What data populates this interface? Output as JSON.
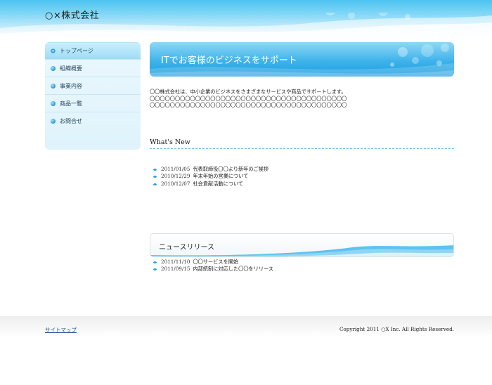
{
  "header": {
    "site_title": "○×株式会社"
  },
  "sidebar": {
    "items": [
      {
        "label": "トップページ",
        "icon": "chevron-up-icon",
        "active": true
      },
      {
        "label": "組織概要",
        "icon": "bullet-icon"
      },
      {
        "label": "事業内容",
        "icon": "bullet-icon"
      },
      {
        "label": "商品一覧",
        "icon": "bullet-icon"
      },
      {
        "label": "お問合せ",
        "icon": "bullet-icon"
      }
    ]
  },
  "main": {
    "banner_title": "ITでお客様のビジネスをサポート",
    "intro_lines": [
      "〇〇株式会社は、中小企業のビジネスをさまざまなサービスや商品でサポートします。",
      "〇〇〇〇〇〇〇〇〇〇〇〇〇〇〇〇〇〇〇〇〇〇〇〇〇〇〇〇〇〇〇〇〇〇〇〇〇〇〇",
      "〇〇〇〇〇〇〇〇〇〇〇〇〇〇〇〇〇〇〇〇〇〇〇〇〇〇〇〇〇〇〇〇〇〇〇〇〇〇〇"
    ],
    "whats_new": {
      "heading": "What's New",
      "items": [
        {
          "date": "2011/01/05",
          "text": "代表取締役〇〇より新年のご挨拶"
        },
        {
          "date": "2010/12/29",
          "text": "年末年始の営業について"
        },
        {
          "date": "2010/12/07",
          "text": "社会貢献活動について"
        }
      ]
    },
    "news_release": {
      "heading": "ニュースリリース",
      "items": [
        {
          "date": "2011/11/10",
          "text": "〇〇サービスを開始"
        },
        {
          "date": "2011/09/15",
          "text": "内部統制に対応した〇〇をリリース"
        }
      ]
    }
  },
  "footer": {
    "sitemap_label": "サイトマップ",
    "copyright": "Copyright 2011 ○X Inc. All Rights Reserved."
  },
  "colors": {
    "accent": "#1b9ee0",
    "header_top": "#4cc4f2",
    "sidebar_bg": "#dff3fc",
    "link": "#2a4a9a"
  }
}
